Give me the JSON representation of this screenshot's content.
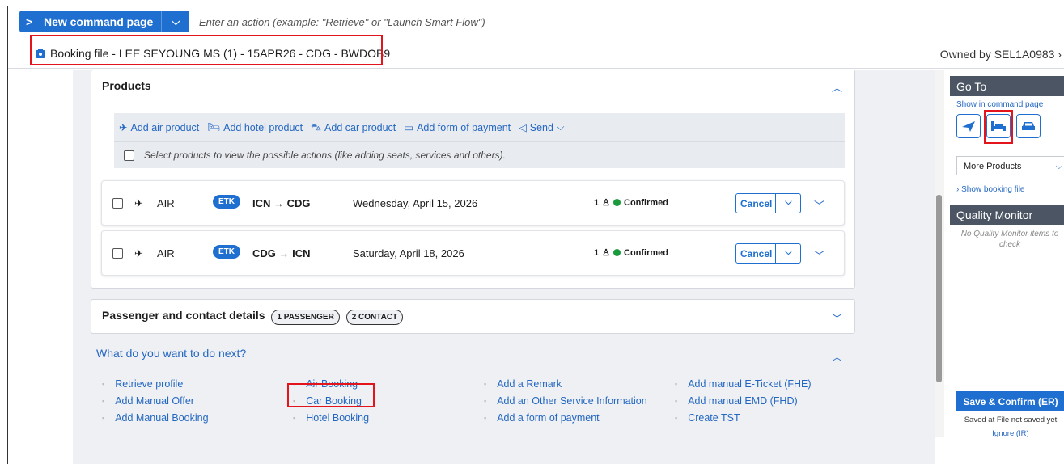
{
  "command_bar": {
    "new_command_label": "New command page",
    "input_placeholder": "Enter an action (example: \"Retrieve\" or \"Launch Smart Flow\")"
  },
  "booking": {
    "title": "Booking file - LEE SEYOUNG MS (1) - 15APR26 - CDG - BWDOB9",
    "owner": "Owned by SEL1A0983"
  },
  "products": {
    "heading": "Products",
    "actions": [
      "Add air product",
      "Add hotel product",
      "Add car product",
      "Add form of payment",
      "Send"
    ],
    "select_hint": "Select products to view the possible actions (like adding seats, services and others).",
    "segments": [
      {
        "type": "AIR",
        "badge": "ETK",
        "route": "ICN → CDG",
        "date": "Wednesday, April 15, 2026",
        "pax": "1",
        "status": "Confirmed",
        "action": "Cancel"
      },
      {
        "type": "AIR",
        "badge": "ETK",
        "route": "CDG → ICN",
        "date": "Saturday, April 18, 2026",
        "pax": "1",
        "status": "Confirmed",
        "action": "Cancel"
      }
    ]
  },
  "passenger": {
    "heading": "Passenger and contact details",
    "pill_passenger": "1 PASSENGER",
    "pill_contact": "2 CONTACT"
  },
  "next": {
    "question": "What do you want to do next?",
    "col1": [
      "Retrieve profile",
      "Add Manual Offer",
      "Add Manual Booking"
    ],
    "col2": [
      "Air Booking",
      "Car Booking",
      "Hotel Booking"
    ],
    "col3": [
      "Add a Remark",
      "Add an Other Service Information",
      "Add a form of payment"
    ],
    "col4": [
      "Add manual E-Ticket (FHE)",
      "Add manual EMD (FHD)",
      "Create TST"
    ]
  },
  "right_panel": {
    "go_to": "Go To",
    "show_in_command": "Show in command page",
    "more_products": "More Products",
    "show_booking_file": "Show booking file",
    "quality_monitor": "Quality Monitor",
    "qm_empty": "No Quality Monitor items to check",
    "save_confirm": "Save & Confirm (ER)",
    "saved_note": "Saved at File not saved yet",
    "ignore": "Ignore (IR)"
  },
  "colors": {
    "accent": "#1f6fd1",
    "highlight": "#e3141c",
    "confirmed": "#1a9a3a"
  }
}
